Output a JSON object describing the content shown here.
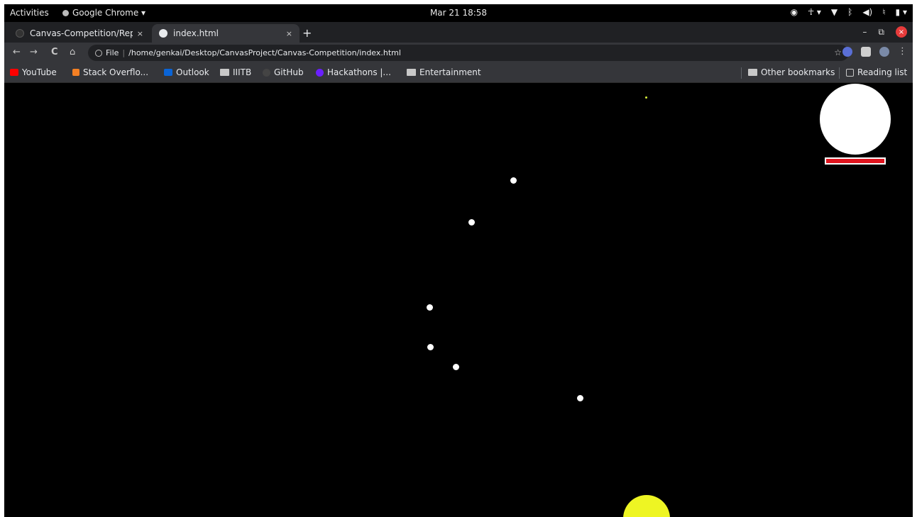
{
  "topbar": {
    "activities": "Activities",
    "app_name": "Google Chrome ▾",
    "clock": "Mar 21  18:58"
  },
  "tabs": [
    {
      "title": "Canvas-Competition/Repo",
      "close": "×"
    },
    {
      "title": "index.html",
      "close": "×"
    }
  ],
  "newtab_label": "+",
  "window_controls": {
    "minimize": "–",
    "restore": "⧉",
    "close": "×"
  },
  "toolbar": {
    "back": "←",
    "forward": "→",
    "reload": "C",
    "home": "⌂",
    "scheme": "File",
    "url": "/home/genkai/Desktop/CanvasProject/Canvas-Competition/index.html",
    "star": "☆",
    "menu": "⋮"
  },
  "bookmarks": [
    {
      "label": "YouTube",
      "color": "#ff0000"
    },
    {
      "label": "Stack Overflo...",
      "color": "#f48024"
    },
    {
      "label": "Outlook",
      "color": "#0a64d6"
    },
    {
      "label": "IIITB",
      "color": "#c8c8c8"
    },
    {
      "label": "GitHub",
      "color": "#444444"
    },
    {
      "label": "Hackathons |...",
      "color": "#6a1fff"
    },
    {
      "label": "Entertainment",
      "color": "#c8c8c8"
    }
  ],
  "bookmarks_right": {
    "other": "Other bookmarks",
    "reading": "Reading list"
  },
  "game": {
    "health_fraction": 1.0,
    "colors": {
      "background": "#000000",
      "dots": "#ffffff",
      "player": "#ffffff",
      "health": "#e0141e",
      "sun": "#eef523"
    }
  }
}
